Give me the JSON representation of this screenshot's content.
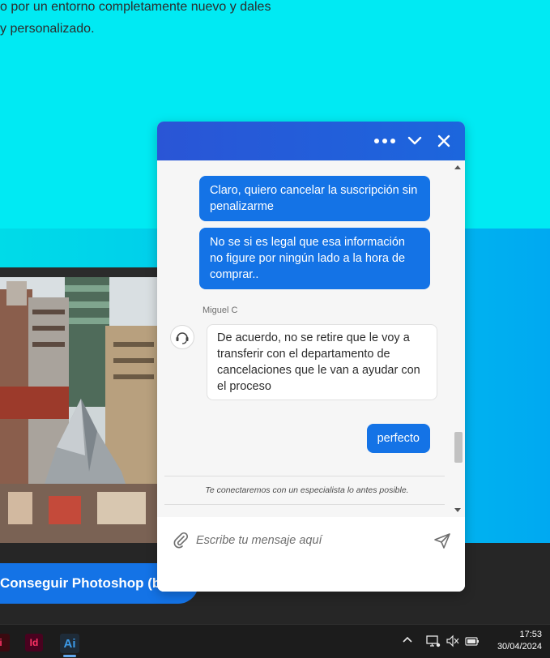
{
  "background_page": {
    "text_line_1": "o por un entorno completamente nuevo y dales",
    "text_line_2": "y personalizado.",
    "cta_label": "Conseguir Photoshop (be"
  },
  "chat": {
    "header": {
      "more_icon": "more-dots-icon",
      "minimize_icon": "chevron-down-icon",
      "close_icon": "close-icon",
      "color_start": "#2a55d6",
      "color_end": "#1c66dd"
    },
    "messages": [
      {
        "from": "user",
        "text": "Claro, quiero cancelar la suscripción sin penalizarme"
      },
      {
        "from": "user",
        "text": "No se si es legal que esa información no figure por ningún lado a la hora de comprar.."
      },
      {
        "from": "agent",
        "name": "Miguel C",
        "text": "De acuerdo, no se retire que le voy a transferir con el departamento de cancelaciones que le van a ayudar con el proceso"
      },
      {
        "from": "user",
        "text": "perfecto"
      }
    ],
    "system_note": "Te conectaremos con un especialista lo antes posible.",
    "composer": {
      "placeholder": "Escribe tu mensaje aquí",
      "attach_icon": "paperclip-icon",
      "send_icon": "send-icon"
    },
    "user_bubble_color": "#1473e6"
  },
  "taskbar": {
    "apps": [
      {
        "label": "i",
        "icon": "app-icon"
      },
      {
        "label": "Id",
        "icon": "indesign-icon"
      },
      {
        "label": "Ai",
        "icon": "illustrator-icon"
      }
    ],
    "tray_icons": [
      "chevron-up-icon",
      "network-icon",
      "mute-icon",
      "battery-icon"
    ],
    "time": "17:53",
    "date": "30/04/2024"
  }
}
